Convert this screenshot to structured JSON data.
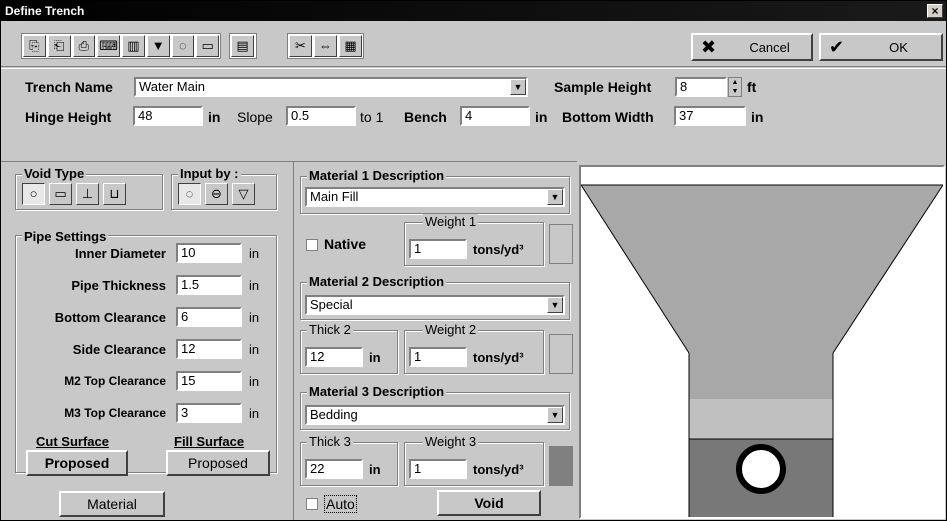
{
  "window": {
    "title": "Define Trench",
    "close_glyph": "×"
  },
  "toolbar": {
    "icons": [
      "copy-icon",
      "paste-icon",
      "print-icon",
      "keyboard-icon",
      "chart-icon",
      "filter-icon",
      "rotate-icon",
      "ruler-icon",
      "text-icon",
      "cut-icon",
      "fit-icon",
      "report-icon"
    ],
    "glyphs": [
      "⎘",
      "⎗",
      "⎙",
      "⌨",
      "▥",
      "▼",
      "◌",
      "▭",
      "▤",
      "✂",
      "⇔",
      "▦"
    ],
    "cancel_label": "Cancel",
    "ok_label": "OK"
  },
  "form": {
    "trench_name_label": "Trench Name",
    "trench_name_value": "Water Main",
    "sample_height_label": "Sample Height",
    "sample_height_value": "8",
    "sample_height_unit": "ft",
    "hinge_height_label": "Hinge Height",
    "hinge_height_value": "48",
    "hinge_height_unit": "in",
    "slope_label": "Slope",
    "slope_value": "0.5",
    "slope_unit": "to 1",
    "bench_label": "Bench",
    "bench_value": "4",
    "bench_unit": "in",
    "bottom_width_label": "Bottom Width",
    "bottom_width_value": "37",
    "bottom_width_unit": "in"
  },
  "void_type": {
    "label": "Void Type"
  },
  "input_by": {
    "label": "Input by :"
  },
  "pipe_settings": {
    "label": "Pipe Settings",
    "rows": [
      {
        "label": "Inner Diameter",
        "value": "10",
        "unit": "in"
      },
      {
        "label": "Pipe Thickness",
        "value": "1.5",
        "unit": "in"
      },
      {
        "label": "Bottom Clearance",
        "value": "6",
        "unit": "in"
      },
      {
        "label": "Side Clearance",
        "value": "12",
        "unit": "in"
      },
      {
        "label": "M2 Top Clearance",
        "value": "15",
        "unit": "in"
      },
      {
        "label": "M3 Top Clearance",
        "value": "3",
        "unit": "in"
      }
    ],
    "cut_surface_label": "Cut Surface",
    "fill_surface_label": "Fill Surface",
    "cut_surface_value": "Proposed",
    "fill_surface_value": "Proposed",
    "material_button": "Material"
  },
  "materials": {
    "m1_desc_label": "Material 1 Description",
    "m1_desc_value": "Main Fill",
    "m1_native_label": "Native",
    "m1_weight_label": "Weight 1",
    "m1_weight_value": "1",
    "m1_weight_unit": "tons/yd³",
    "m2_desc_label": "Material 2 Description",
    "m2_desc_value": "Special",
    "m2_thick_label": "Thick 2",
    "m2_thick_value": "12",
    "m2_thick_unit": "in",
    "m2_weight_label": "Weight 2",
    "m2_weight_value": "1",
    "m2_weight_unit": "tons/yd³",
    "m3_desc_label": "Material 3 Description",
    "m3_desc_value": "Bedding",
    "m3_thick_label": "Thick 3",
    "m3_thick_value": "22",
    "m3_thick_unit": "in",
    "m3_weight_label": "Weight 3",
    "m3_weight_value": "1",
    "m3_weight_unit": "tons/yd³",
    "auto_label": "Auto",
    "void_button": "Void",
    "colors": {
      "m1": "#c8c8c8",
      "m2": "#c8c8c8",
      "m3": "#808080"
    }
  },
  "preview": {
    "colors": {
      "fill": "#a8a8a8",
      "special": "#c0c0c0",
      "bedding": "#787878",
      "pipe": "#ffffff",
      "background": "#ffffff"
    }
  }
}
